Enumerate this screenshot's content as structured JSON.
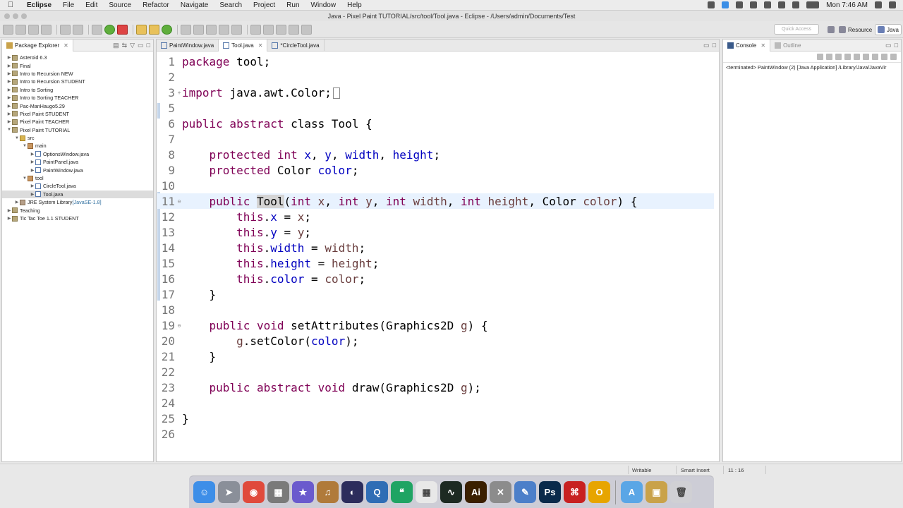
{
  "menubar": {
    "app_name": "Eclipse",
    "items": [
      "File",
      "Edit",
      "Source",
      "Refactor",
      "Navigate",
      "Search",
      "Project",
      "Run",
      "Window",
      "Help"
    ],
    "clock": "Mon 7:46 AM"
  },
  "window": {
    "title": "Java - Pixel Paint TUTORIAL/src/tool/Tool.java - Eclipse - /Users/admin/Documents/Test"
  },
  "toolbar": {
    "quick_access_placeholder": "Quick Access",
    "perspective_resource": "Resource",
    "perspective_java": "Java"
  },
  "package_explorer": {
    "title": "Package Explorer",
    "tree": [
      {
        "label": "Asteroid 6.3",
        "depth": 0,
        "icon": "project-icon",
        "expanded": false
      },
      {
        "label": "Final",
        "depth": 0,
        "icon": "project-icon",
        "expanded": false
      },
      {
        "label": "Intro to Recursion NEW",
        "depth": 0,
        "icon": "project-icon",
        "expanded": false
      },
      {
        "label": "Intro to Recursion STUDENT",
        "depth": 0,
        "icon": "project-icon",
        "expanded": false
      },
      {
        "label": "Intro to Sorting",
        "depth": 0,
        "icon": "project-icon",
        "expanded": false
      },
      {
        "label": "Intro to Sorting TEACHER",
        "depth": 0,
        "icon": "project-icon",
        "expanded": false
      },
      {
        "label": "Pac-ManHaugo5.29",
        "depth": 0,
        "icon": "project-icon",
        "expanded": false
      },
      {
        "label": "Pixel Paint STUDENT",
        "depth": 0,
        "icon": "project-icon",
        "expanded": false
      },
      {
        "label": "Pixel Paint TEACHER",
        "depth": 0,
        "icon": "project-icon",
        "expanded": false
      },
      {
        "label": "Pixel Paint TUTORIAL",
        "depth": 0,
        "icon": "project-icon",
        "expanded": true
      },
      {
        "label": "src",
        "depth": 1,
        "icon": "source-folder-icon",
        "expanded": true
      },
      {
        "label": "main",
        "depth": 2,
        "icon": "package-icon",
        "expanded": true
      },
      {
        "label": "OptionsWindow.java",
        "depth": 3,
        "icon": "java-file-icon",
        "expanded": false
      },
      {
        "label": "PaintPanel.java",
        "depth": 3,
        "icon": "java-file-icon",
        "expanded": false
      },
      {
        "label": "PaintWindow.java",
        "depth": 3,
        "icon": "java-file-icon",
        "expanded": false
      },
      {
        "label": "tool",
        "depth": 2,
        "icon": "package-icon",
        "expanded": true
      },
      {
        "label": "CircleTool.java",
        "depth": 3,
        "icon": "java-file-icon",
        "expanded": false
      },
      {
        "label": "Tool.java",
        "depth": 3,
        "icon": "java-file-icon",
        "expanded": false,
        "selected": true
      },
      {
        "label": "JRE System Library",
        "decoration": "[JavaSE-1.8]",
        "depth": 1,
        "icon": "library-icon",
        "expanded": false
      },
      {
        "label": "Teaching",
        "depth": 0,
        "icon": "project-icon",
        "expanded": false
      },
      {
        "label": "Tic Tac Toe 1.1 STUDENT",
        "depth": 0,
        "icon": "project-icon",
        "expanded": false
      }
    ]
  },
  "editor": {
    "tabs": [
      {
        "label": "PaintWindow.java",
        "active": false
      },
      {
        "label": "Tool.java",
        "active": true
      },
      {
        "label": "*CircleTool.java",
        "active": false
      }
    ],
    "current_line": 11,
    "lines": [
      {
        "n": "1",
        "fold": "",
        "tokens": [
          [
            "kw",
            "package"
          ],
          [
            "",
            "tool;"
          ]
        ]
      },
      {
        "n": "2",
        "fold": "",
        "tokens": []
      },
      {
        "n": "3",
        "fold": "+",
        "tokens": [
          [
            "kw",
            "import"
          ],
          [
            "",
            "java.awt.Color;"
          ]
        ],
        "collapsed": true
      },
      {
        "n": "5",
        "fold": "",
        "tokens": []
      },
      {
        "n": "6",
        "fold": "",
        "tokens": [
          [
            "kw",
            "public abstract"
          ],
          [
            "",
            "class Tool {"
          ]
        ]
      },
      {
        "n": "7",
        "fold": "",
        "tokens": []
      },
      {
        "n": "8",
        "fold": "",
        "tokens": [
          [
            "",
            "    "
          ],
          [
            "kw",
            "protected int"
          ],
          [
            "fld",
            "x"
          ],
          [
            "",
            ","
          ],
          [
            "fld",
            "y"
          ],
          [
            "",
            ","
          ],
          [
            "fld",
            "width"
          ],
          [
            "",
            ","
          ],
          [
            "fld",
            "height"
          ],
          [
            "",
            ";"
          ]
        ]
      },
      {
        "n": "9",
        "fold": "",
        "tokens": [
          [
            "",
            "    "
          ],
          [
            "kw",
            "protected"
          ],
          [
            "",
            "Color "
          ],
          [
            "fld",
            "color"
          ],
          [
            "",
            ";"
          ]
        ]
      },
      {
        "n": "10",
        "fold": "",
        "tokens": []
      },
      {
        "n": "11",
        "fold": "-",
        "tokens": [
          [
            "",
            "    "
          ],
          [
            "kw",
            "public"
          ],
          [
            "hl",
            "Tool"
          ],
          [
            "",
            "("
          ],
          [
            "kw",
            "int"
          ],
          [
            "prm",
            "x"
          ],
          [
            "",
            ", "
          ],
          [
            "kw",
            "int"
          ],
          [
            "prm",
            "y"
          ],
          [
            "",
            ", "
          ],
          [
            "kw",
            "int"
          ],
          [
            "prm",
            "width"
          ],
          [
            "",
            ", "
          ],
          [
            "kw",
            "int"
          ],
          [
            "prm",
            "height"
          ],
          [
            "",
            ", Color "
          ],
          [
            "prm",
            "color"
          ],
          [
            "",
            ") {"
          ]
        ]
      },
      {
        "n": "12",
        "fold": "",
        "tokens": [
          [
            "",
            "        "
          ],
          [
            "kw",
            "this"
          ],
          [
            "",
            "."
          ],
          [
            "fld",
            "x"
          ],
          [
            "",
            " = "
          ],
          [
            "prm",
            "x"
          ],
          [
            "",
            ";"
          ]
        ]
      },
      {
        "n": "13",
        "fold": "",
        "tokens": [
          [
            "",
            "        "
          ],
          [
            "kw",
            "this"
          ],
          [
            "",
            "."
          ],
          [
            "fld",
            "y"
          ],
          [
            "",
            " = "
          ],
          [
            "prm",
            "y"
          ],
          [
            "",
            ";"
          ]
        ]
      },
      {
        "n": "14",
        "fold": "",
        "tokens": [
          [
            "",
            "        "
          ],
          [
            "kw",
            "this"
          ],
          [
            "",
            "."
          ],
          [
            "fld",
            "width"
          ],
          [
            "",
            " = "
          ],
          [
            "prm",
            "width"
          ],
          [
            "",
            ";"
          ]
        ]
      },
      {
        "n": "15",
        "fold": "",
        "tokens": [
          [
            "",
            "        "
          ],
          [
            "kw",
            "this"
          ],
          [
            "",
            "."
          ],
          [
            "fld",
            "height"
          ],
          [
            "",
            " = "
          ],
          [
            "prm",
            "height"
          ],
          [
            "",
            ";"
          ]
        ]
      },
      {
        "n": "16",
        "fold": "",
        "tokens": [
          [
            "",
            "        "
          ],
          [
            "kw",
            "this"
          ],
          [
            "",
            "."
          ],
          [
            "fld",
            "color"
          ],
          [
            "",
            " = "
          ],
          [
            "prm",
            "color"
          ],
          [
            "",
            ";"
          ]
        ]
      },
      {
        "n": "17",
        "fold": "",
        "tokens": [
          [
            "",
            "    }"
          ]
        ]
      },
      {
        "n": "18",
        "fold": "",
        "tokens": []
      },
      {
        "n": "19",
        "fold": "-",
        "tokens": [
          [
            "",
            "    "
          ],
          [
            "kw",
            "public void"
          ],
          [
            "",
            "setAttributes(Graphics2D "
          ],
          [
            "prm",
            "g"
          ],
          [
            "",
            ") {"
          ]
        ]
      },
      {
        "n": "20",
        "fold": "",
        "tokens": [
          [
            "",
            "        "
          ],
          [
            "prm",
            "g"
          ],
          [
            "",
            ".setColor("
          ],
          [
            "fld",
            "color"
          ],
          [
            "",
            ");"
          ]
        ]
      },
      {
        "n": "21",
        "fold": "",
        "tokens": [
          [
            "",
            "    }"
          ]
        ]
      },
      {
        "n": "22",
        "fold": "",
        "tokens": []
      },
      {
        "n": "23",
        "fold": "",
        "tokens": [
          [
            "",
            "    "
          ],
          [
            "kw",
            "public abstract void"
          ],
          [
            "",
            "draw(Graphics2D "
          ],
          [
            "prm",
            "g"
          ],
          [
            "",
            ");"
          ]
        ]
      },
      {
        "n": "24",
        "fold": "",
        "tokens": []
      },
      {
        "n": "25",
        "fold": "",
        "tokens": [
          [
            "",
            "}"
          ]
        ]
      },
      {
        "n": "26",
        "fold": "",
        "tokens": []
      }
    ]
  },
  "right_panel": {
    "tab_console": "Console",
    "tab_outline": "Outline",
    "console_text": "<terminated> PaintWindow (2) [Java Application] /Library/Java/JavaVir"
  },
  "statusbar": {
    "mode": "Writable",
    "insert_mode": "Smart Insert",
    "position": "11 : 16"
  },
  "dock": {
    "apps": [
      {
        "name": "finder-icon",
        "color": "#3d8ee8",
        "glyph": "☺"
      },
      {
        "name": "launchpad-icon",
        "color": "#8a8f99",
        "glyph": "➤"
      },
      {
        "name": "chrome-icon",
        "color": "#e04a3c",
        "glyph": "◉"
      },
      {
        "name": "calculator-icon",
        "color": "#7a7a7a",
        "glyph": "▦"
      },
      {
        "name": "imovie-icon",
        "color": "#6a5acd",
        "glyph": "★"
      },
      {
        "name": "guitar-icon",
        "color": "#b07a3a",
        "glyph": "♫"
      },
      {
        "name": "eclipse-icon",
        "color": "#2c2d5c",
        "glyph": "◐"
      },
      {
        "name": "quicktime-icon",
        "color": "#2f6db5",
        "glyph": "Q"
      },
      {
        "name": "hangouts-icon",
        "color": "#1fa463",
        "glyph": "❝"
      },
      {
        "name": "slack-icon",
        "color": "#e8e8e8",
        "glyph": "▦"
      },
      {
        "name": "activity-monitor-icon",
        "color": "#1d2a22",
        "glyph": "∿"
      },
      {
        "name": "illustrator-icon",
        "color": "#3a1f00",
        "glyph": "Ai"
      },
      {
        "name": "xcode-tools-icon",
        "color": "#8c8c8c",
        "glyph": "✕"
      },
      {
        "name": "textedit-icon",
        "color": "#4c7fc9",
        "glyph": "✎"
      },
      {
        "name": "photoshop-icon",
        "color": "#0a2a4a",
        "glyph": "Ps"
      },
      {
        "name": "acrobat-icon",
        "color": "#c82121",
        "glyph": "⌘"
      },
      {
        "name": "omnifocus-icon",
        "color": "#e7a500",
        "glyph": "O"
      },
      {
        "name": "applications-folder-icon",
        "color": "#5aa6e6",
        "glyph": "A"
      },
      {
        "name": "archive-icon",
        "color": "#c9a24a",
        "glyph": "▣"
      },
      {
        "name": "trash-icon",
        "color": "#d0d0d4",
        "glyph": "🗑"
      }
    ]
  }
}
